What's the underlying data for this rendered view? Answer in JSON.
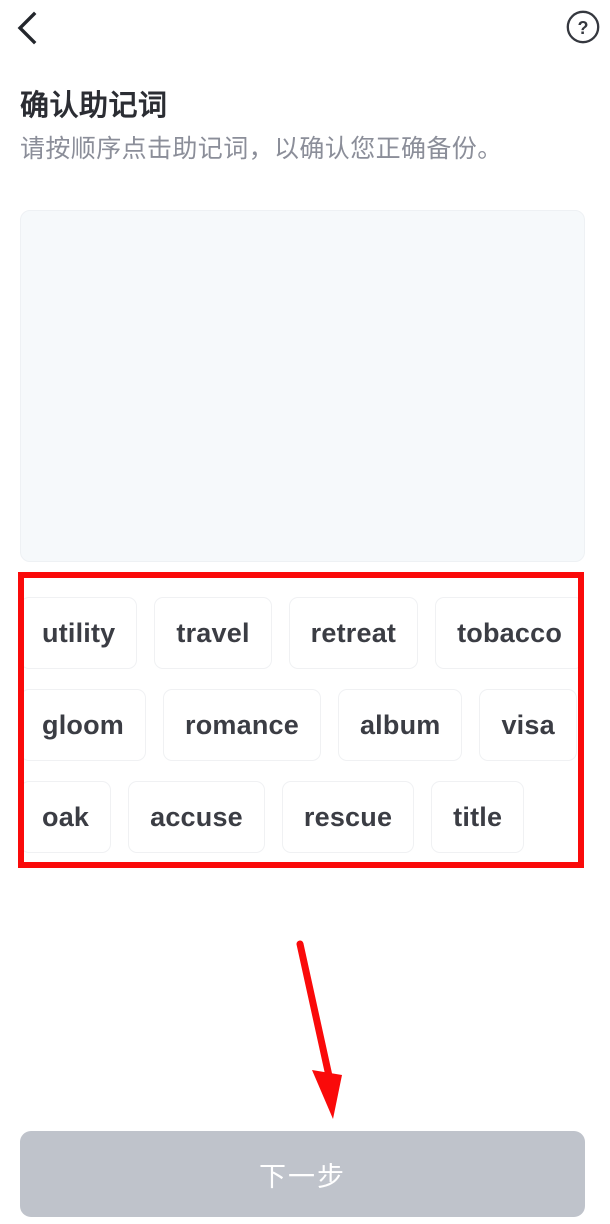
{
  "topbar": {
    "back_icon": "chevron-left-icon",
    "help_icon": "help-circle-icon",
    "help_glyph": "?"
  },
  "header": {
    "title": "确认助记词",
    "subtitle": "请按顺序点击助记词，以确认您正确备份。"
  },
  "answer_panel": {
    "selected_words": []
  },
  "word_bank": {
    "rows": [
      {
        "words": [
          "utility",
          "travel",
          "retreat",
          "tobacco"
        ]
      },
      {
        "words": [
          "gloom",
          "romance",
          "album",
          "visa"
        ]
      },
      {
        "words": [
          "oak",
          "accuse",
          "rescue",
          "title"
        ]
      }
    ],
    "all_words": [
      "utility",
      "travel",
      "retreat",
      "tobacco",
      "gloom",
      "romance",
      "album",
      "visa",
      "oak",
      "accuse",
      "rescue",
      "title"
    ]
  },
  "footer": {
    "next_label": "下一步",
    "next_enabled": false
  },
  "annotations": {
    "highlight_box_color": "#fa0a0a",
    "arrow_color": "#fa0a0a",
    "arrow_target": "next-button"
  },
  "colors": {
    "background": "#ffffff",
    "title_text": "#2b2d33",
    "subtitle_text": "#8b8e99",
    "chip_text": "#3b3d44",
    "chip_background": "#ffffff",
    "panel_background": "#f6f9fb",
    "button_disabled": "#bfc3cb",
    "button_text": "#ffffff",
    "annotation_red": "#fa0a0a"
  }
}
